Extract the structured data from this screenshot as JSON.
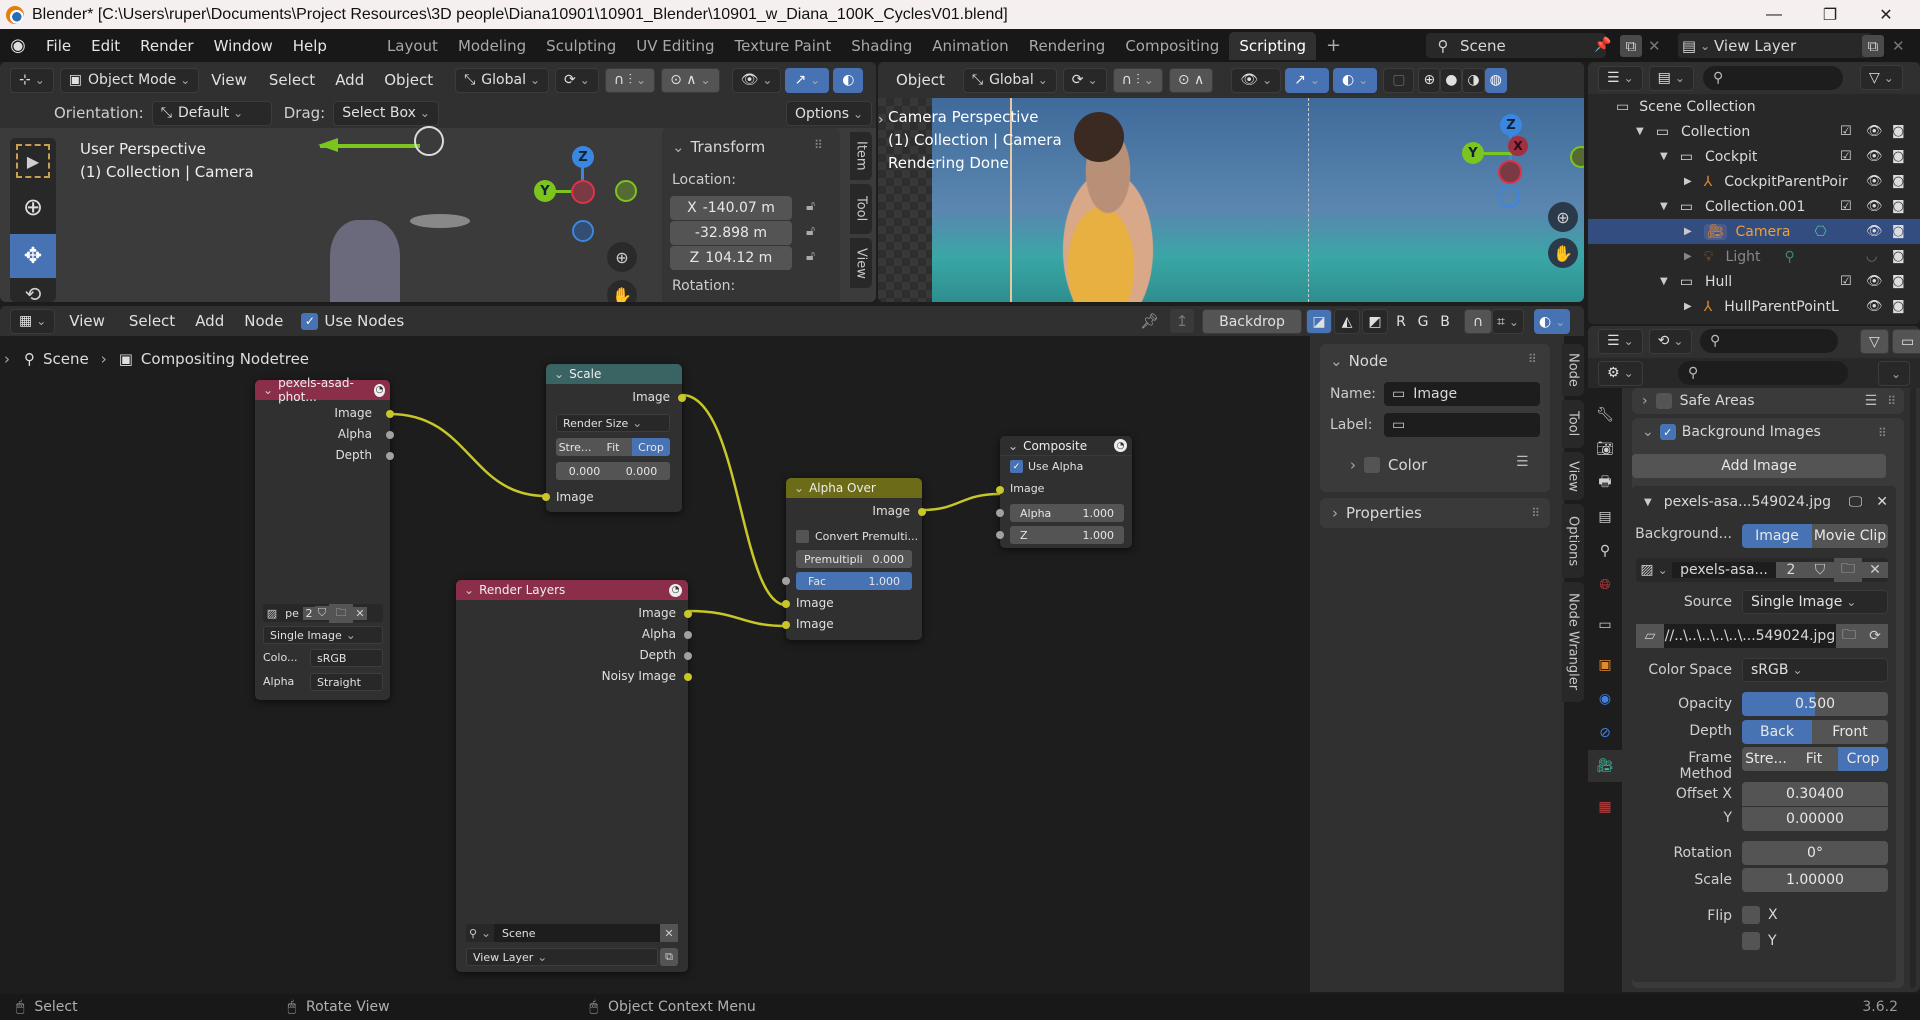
{
  "window": {
    "title": "Blender* [C:\\Users\\ruper\\Documents\\Project Resources\\3D people\\Diana10901\\10901_Blender\\10901_w_Diana_100K_CyclesV01.blend]",
    "minimize": "—",
    "maximize": "❐",
    "close": "✕"
  },
  "topbar": {
    "menus": [
      "File",
      "Edit",
      "Render",
      "Window",
      "Help"
    ],
    "workspaces": [
      "Layout",
      "Modeling",
      "Sculpting",
      "UV Editing",
      "Texture Paint",
      "Shading",
      "Animation",
      "Rendering",
      "Compositing",
      "Scripting"
    ],
    "active_workspace": "Scripting",
    "add_workspace": "+",
    "scene": "Scene",
    "view_layer": "View Layer"
  },
  "viewport_left": {
    "mode": "Object Mode",
    "menus": [
      "View",
      "Select",
      "Add",
      "Object"
    ],
    "transform_orientation": "Global",
    "orientation_label": "Orientation:",
    "orientation_value": "Default",
    "drag_label": "Drag:",
    "drag_value": "Select Box",
    "options_label": "Options",
    "overlay_line1": "User Perspective",
    "overlay_line2": "(1) Collection | Camera",
    "gizmo": {
      "z": "Z",
      "y": "Y"
    },
    "transform_panel": {
      "title": "Transform",
      "location_label": "Location:",
      "x_label": "X",
      "x_value": "-140.07 m",
      "y_value": "-32.898 m",
      "z_label": "Z",
      "z_value": "104.12 m",
      "rotation_label": "Rotation:"
    },
    "side_tabs": [
      "Item",
      "Tool",
      "View"
    ]
  },
  "viewport_right": {
    "mode": "Object",
    "transform_orientation": "Global",
    "overlay_line1": "Camera Perspective",
    "overlay_line2": "(1) Collection | Camera",
    "overlay_line3": "Rendering Done",
    "gizmo": {
      "z": "Z",
      "y": "Y",
      "x": "X"
    }
  },
  "outliner": {
    "search_placeholder": "",
    "rows": [
      {
        "label": "Scene Collection",
        "depth": 0,
        "type": "collection"
      },
      {
        "label": "Collection",
        "depth": 1,
        "type": "collection",
        "checked": true
      },
      {
        "label": "Cockpit",
        "depth": 2,
        "type": "collection",
        "checked": true
      },
      {
        "label": "CockpitParentPoir",
        "depth": 3,
        "type": "empty"
      },
      {
        "label": "Collection.001",
        "depth": 2,
        "type": "collection",
        "checked": true
      },
      {
        "label": "Camera",
        "depth": 3,
        "type": "camera",
        "selected": true
      },
      {
        "label": "Light",
        "depth": 3,
        "type": "light",
        "hidden": true
      },
      {
        "label": "Hull",
        "depth": 2,
        "type": "collection",
        "checked": true
      },
      {
        "label": "HullParentPointL",
        "depth": 3,
        "type": "empty"
      }
    ]
  },
  "node_editor": {
    "header_menus": [
      "View",
      "Select",
      "Add",
      "Node"
    ],
    "use_nodes_label": "Use Nodes",
    "use_nodes_checked": true,
    "backdrop_label": "Backdrop",
    "channel_buttons": [
      "R",
      "G",
      "B"
    ],
    "breadcrumb": [
      "Scene",
      "Compositing Nodetree"
    ],
    "nodes": {
      "image": {
        "title": "pexels-asad-phot...",
        "outputs": [
          "Image",
          "Alpha",
          "Depth"
        ],
        "image_name": "pe",
        "users": "2",
        "source": "Single Image",
        "color_label": "Colo...",
        "color_value": "sRGB",
        "alpha_label": "Alpha",
        "alpha_value": "Straight"
      },
      "scale": {
        "title": "Scale",
        "output": "Image",
        "space": "Render Size",
        "fit_options": [
          "Stre...",
          "Fit",
          "Crop"
        ],
        "fit_active": "Crop",
        "offset_x": "0.000",
        "offset_y": "0.000",
        "input": "Image"
      },
      "alpha_over": {
        "title": "Alpha Over",
        "output": "Image",
        "convert_label": "Convert Premulti...",
        "premul_label": "Premultipli",
        "premul_value": "0.000",
        "fac_label": "Fac",
        "fac_value": "1.000",
        "inputs": [
          "Image",
          "Image"
        ]
      },
      "composite": {
        "title": "Composite",
        "use_alpha_label": "Use Alpha",
        "use_alpha_checked": true,
        "input": "Image",
        "alpha_label": "Alpha",
        "alpha_value": "1.000",
        "z_label": "Z",
        "z_value": "1.000"
      },
      "render_layers": {
        "title": "Render Layers",
        "outputs": [
          "Image",
          "Alpha",
          "Depth",
          "Noisy Image"
        ],
        "scene": "Scene",
        "view_layer": "View Layer"
      }
    },
    "sidebar": {
      "node_panel": "Node",
      "name_label": "Name:",
      "name_value": "Image",
      "label_label": "Label:",
      "label_value": "",
      "color_label": "Color",
      "properties_label": "Properties",
      "tabs": [
        "Node",
        "Tool",
        "View",
        "Options",
        "Node Wrangler"
      ]
    }
  },
  "properties": {
    "safe_areas_label": "Safe Areas",
    "background_images_label": "Background Images",
    "background_images_checked": true,
    "add_image_label": "Add Image",
    "image_entry_name": "pexels-asa...549024.jpg",
    "background_label": "Background...",
    "bg_source_options": [
      "Image",
      "Movie Clip"
    ],
    "bg_source_active": "Image",
    "image_datablock": "pexels-asa...",
    "image_users": "2",
    "source_label": "Source",
    "source_value": "Single Image",
    "filepath": "//..\\..\\..\\..\\..\\...549024.jpg",
    "color_space_label": "Color Space",
    "color_space_value": "sRGB",
    "opacity_label": "Opacity",
    "opacity_value": "0.500",
    "opacity_fraction": 0.5,
    "depth_label": "Depth",
    "depth_options": [
      "Back",
      "Front"
    ],
    "depth_active": "Back",
    "frame_method_label": "Frame Method",
    "frame_method_options": [
      "Stre...",
      "Fit",
      "Crop"
    ],
    "frame_method_active": "Crop",
    "offset_x_label": "Offset X",
    "offset_x_value": "0.30400",
    "offset_y_label": "Y",
    "offset_y_value": "0.00000",
    "rotation_label": "Rotation",
    "rotation_value": "0°",
    "scale_label": "Scale",
    "scale_value": "1.00000",
    "flip_label": "Flip",
    "flip_x_label": "X",
    "flip_y_label": "Y"
  },
  "statusbar": {
    "items": [
      "Select",
      "Rotate View",
      "Object Context Menu"
    ],
    "version": "3.6.2"
  },
  "colors": {
    "accent_blue": "#4772b3",
    "selected_orange": "#f0a030",
    "image_node_header": "#8a2e4a",
    "scale_node_header": "#3a6363",
    "alpha_over_header": "#6b6b18",
    "composite_header": "#2e2e2e",
    "render_layers_header": "#8a2e4a",
    "socket_yellow": "#c7c729",
    "socket_gray": "#a1a1a1"
  }
}
